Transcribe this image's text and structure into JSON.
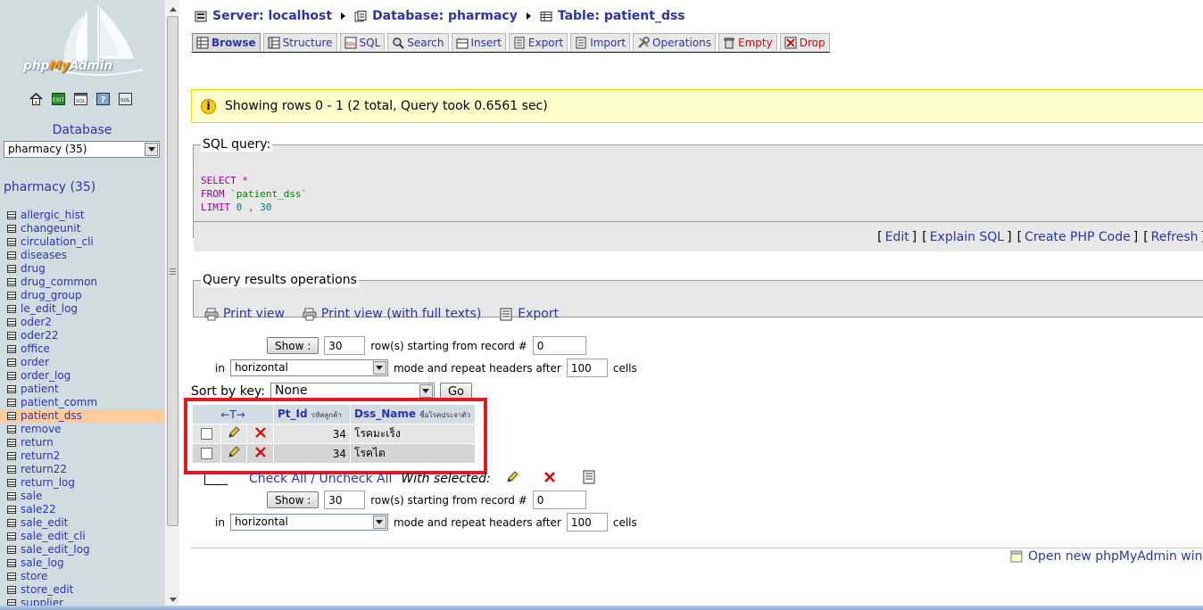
{
  "nav": {
    "logo": "phpMyAdmin",
    "logo_parts": [
      "php",
      "My",
      "Admin"
    ],
    "icons": [
      "home-icon",
      "exit-icon",
      "sql-window-icon",
      "help-icon",
      "docs-icon"
    ],
    "database_label": "Database",
    "database_select": "pharmacy (35)",
    "database_heading": "pharmacy (35)",
    "tables": [
      "allergic_hist",
      "changeunit",
      "circulation_cli",
      "diseases",
      "drug",
      "drug_common",
      "drug_group",
      "le_edit_log",
      "oder2",
      "oder22",
      "office",
      "order",
      "order_log",
      "patient",
      "patient_comm",
      "patient_dss",
      "remove",
      "return",
      "return2",
      "return22",
      "return_log",
      "sale",
      "sale22",
      "sale_edit",
      "sale_edit_cli",
      "sale_edit_log",
      "sale_log",
      "store",
      "store_edit",
      "supplier"
    ],
    "active_table": "patient_dss"
  },
  "breadcrumb": {
    "server": "Server: localhost",
    "database": "Database: pharmacy",
    "table": "Table: patient_dss"
  },
  "tabs": [
    {
      "label": "Browse",
      "icon": "browse-icon",
      "active": true
    },
    {
      "label": "Structure",
      "icon": "structure-icon"
    },
    {
      "label": "SQL",
      "icon": "sql-icon"
    },
    {
      "label": "Search",
      "icon": "search-icon"
    },
    {
      "label": "Insert",
      "icon": "insert-icon"
    },
    {
      "label": "Export",
      "icon": "export-icon"
    },
    {
      "label": "Import",
      "icon": "import-icon"
    },
    {
      "label": "Operations",
      "icon": "operations-icon"
    },
    {
      "label": "Empty",
      "icon": "empty-icon",
      "danger": true
    },
    {
      "label": "Drop",
      "icon": "drop-icon",
      "danger": true
    }
  ],
  "notice": "Showing rows 0 - 1 (2 total, Query took 0.6561 sec)",
  "sql": {
    "legend": "SQL query:",
    "select_kw": "SELECT",
    "select_rest": " *",
    "from_kw": "FROM",
    "from_table": " `patient_dss`",
    "limit_kw": "LIMIT",
    "limit_vals": " 0 , 30",
    "links": [
      "Edit",
      "Explain SQL",
      "Create PHP Code",
      "Refresh"
    ]
  },
  "query_ops": {
    "legend": "Query results operations",
    "links": [
      "Print view",
      "Print view (with full texts)",
      "Export"
    ]
  },
  "paging": {
    "show_label": "Show :",
    "rows": "30",
    "rows_text": "row(s) starting from record #",
    "start": "0",
    "in_label": "in",
    "mode": "horizontal",
    "mode_text": "mode and repeat headers after",
    "repeat": "100",
    "cells_text": "cells"
  },
  "sort": {
    "label": "Sort by key:",
    "value": "None",
    "go": "Go"
  },
  "results": {
    "columns": [
      {
        "name": "Pt_Id",
        "sub": "รหัสลูกค้า"
      },
      {
        "name": "Dss_Name",
        "sub": "ชื่อโรคประจาตัว"
      }
    ],
    "rows": [
      {
        "pt_id": "34",
        "dss_name": "โรคมะเร็ง"
      },
      {
        "pt_id": "34",
        "dss_name": "โรคไต"
      }
    ]
  },
  "check_all": "Check All / Uncheck All",
  "with_selected": "With selected:",
  "open_new_window": "Open new phpMyAdmin windo",
  "colors": {
    "nav_bg": "#d0dce0",
    "link": "#2a34b0",
    "active_row": "#ffcc99",
    "notice_bg": "#ffffcc",
    "highlight": "#e01a22"
  }
}
